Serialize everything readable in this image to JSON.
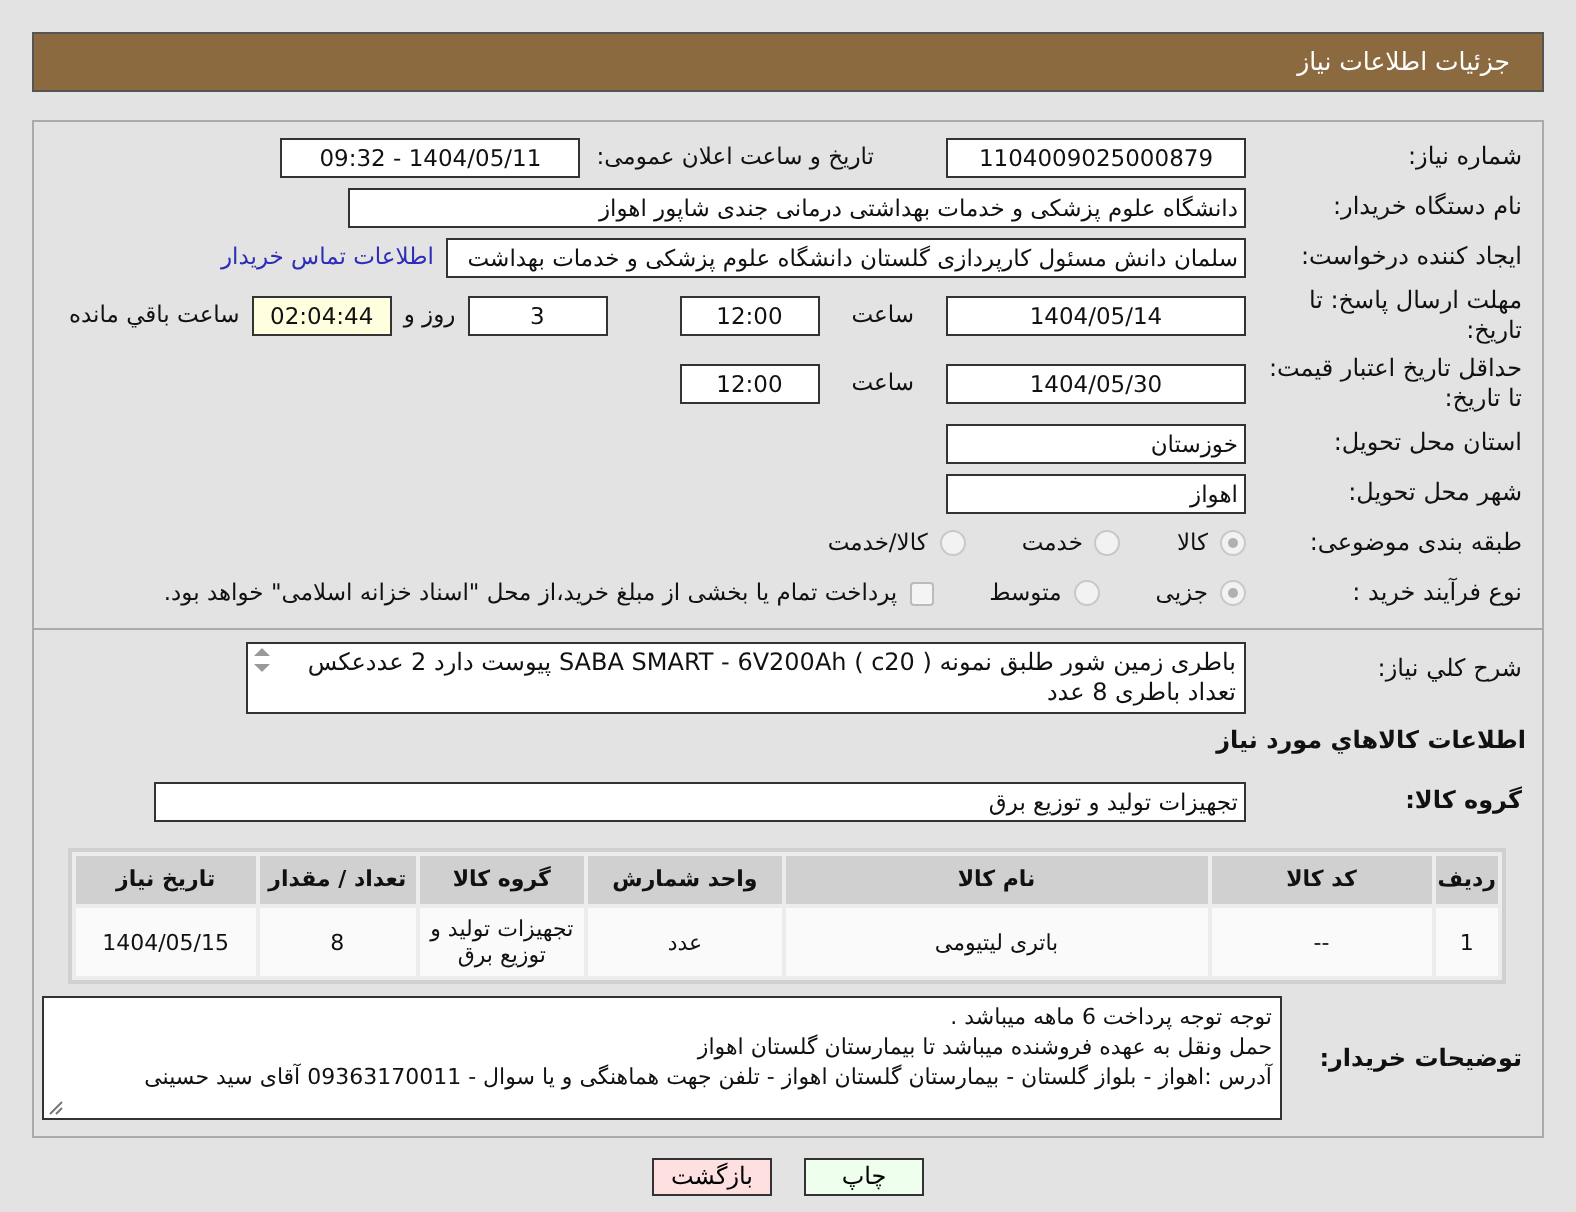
{
  "header": {
    "title": "جزئیات اطلاعات نیاز"
  },
  "need_number": {
    "label": "شماره نیاز:",
    "value": "1104009025000879"
  },
  "announcement": {
    "label": "تاریخ و ساعت اعلان عمومی:",
    "value": "1404/05/11 - 09:32"
  },
  "buyer_org": {
    "label": "نام دستگاه خریدار:",
    "value": "دانشگاه علوم پزشکی و خدمات بهداشتی درمانی جندی شاپور اهواز"
  },
  "requester": {
    "label": "ایجاد کننده درخواست:",
    "value": "سلمان دانش مسئول کارپردازی گلستان دانشگاه علوم پزشکی و خدمات بهداشت",
    "link": "اطلاعات تماس خریدار"
  },
  "response_deadline": {
    "label": "مهلت ارسال پاسخ: تا تاریخ:",
    "date": "1404/05/14",
    "time_label": "ساعت",
    "time": "12:00",
    "days": "3",
    "days_label": "روز و",
    "remaining": "02:04:44",
    "remaining_label": "ساعت باقي مانده"
  },
  "price_validity": {
    "label": "حداقل تاریخ اعتبار قیمت: تا تاریخ:",
    "date": "1404/05/30",
    "time_label": "ساعت",
    "time": "12:00"
  },
  "province": {
    "label": "استان محل تحویل:",
    "value": "خوزستان"
  },
  "city": {
    "label": "شهر محل تحویل:",
    "value": "اهواز"
  },
  "category": {
    "label": "طبقه بندی موضوعی:",
    "options": [
      {
        "label": "کالا",
        "selected": true
      },
      {
        "label": "خدمت",
        "selected": false
      },
      {
        "label": "کالا/خدمت",
        "selected": false
      }
    ]
  },
  "process": {
    "label": "نوع فرآیند خرید :",
    "options": [
      {
        "label": "جزیی",
        "selected": true
      },
      {
        "label": "متوسط",
        "selected": false
      }
    ],
    "treasury": {
      "label": "پرداخت تمام یا بخشی از مبلغ خرید،از محل \"اسناد خزانه اسلامی\" خواهد بود.",
      "checked": false
    }
  },
  "description": {
    "label": "شرح کلي نیاز:",
    "value": "باطری زمین شور طلبق نمونه ( SABA SMART - 6V200Ah ( c20   پیوست دارد 2 عددعکس تعداد باطری 8 عدد"
  },
  "goods_heading": "اطلاعات کالاهاي مورد نیاز",
  "goods_group": {
    "label": "گروه کالا:",
    "value": "تجهیزات تولید و توزیع برق"
  },
  "table": {
    "columns": [
      "ردیف",
      "کد کالا",
      "نام کالا",
      "واحد شمارش",
      "گروه کالا",
      "تعداد / مقدار",
      "تاریخ نیاز"
    ],
    "rows": [
      [
        "1",
        "--",
        "باتری لیتیومی",
        "عدد",
        "تجهیزات تولید و توزیع برق",
        "8",
        "1404/05/15"
      ]
    ]
  },
  "buyer_notes": {
    "label": "توضیحات خریدار:",
    "lines": [
      "توجه توجه پرداخت 6 ماهه میباشد .",
      "حمل ونقل به عهده فروشنده میباشد تا بیمارستان گلستان اهواز",
      "آدرس :اهواز - بلواز گلستان - بیمارستان گلستان اهواز - تلفن جهت هماهنگی و یا سوال - 09363170011 آقای سید حسینی"
    ]
  },
  "buttons": [
    {
      "label": "چاپ",
      "kind": "print"
    },
    {
      "label": "بازگشت",
      "kind": "back"
    }
  ]
}
